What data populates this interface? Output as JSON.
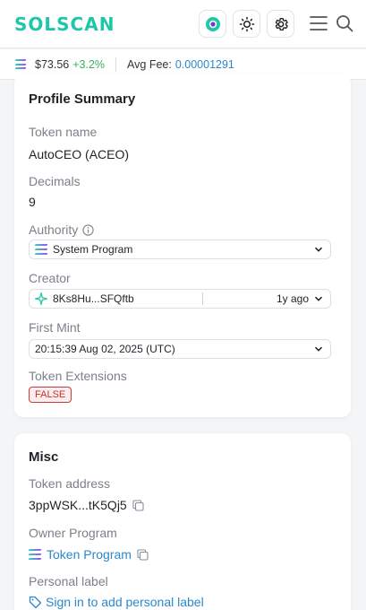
{
  "header": {
    "logo_text": "SOLSCAN",
    "icons": [
      "solscan-app-icon",
      "sun-icon",
      "gear-icon",
      "hamburger-menu-icon",
      "search-icon"
    ]
  },
  "pricebar": {
    "price": "$73.56",
    "change": "+3.2%",
    "fee_label": "Avg Fee:",
    "fee_value": "0.00001291"
  },
  "profile": {
    "title": "Profile Summary",
    "token_name_label": "Token name",
    "token_name": "AutoCEO (ACEO)",
    "decimals_label": "Decimals",
    "decimals": "9",
    "authority_label": "Authority",
    "authority_value": "System Program",
    "creator_label": "Creator",
    "creator_value": "8Ks8Hu...SFQftb",
    "creator_age": "1y ago",
    "first_mint_label": "First Mint",
    "first_mint_value": "20:15:39 Aug 02, 2025 (UTC)",
    "extensions_label": "Token Extensions",
    "extensions_value": "FALSE"
  },
  "misc": {
    "title": "Misc",
    "token_address_label": "Token address",
    "token_address": "3ppWSK...tK5Qj5",
    "owner_program_label": "Owner Program",
    "owner_program": "Token Program",
    "personal_label_label": "Personal label",
    "personal_label_link": "Sign in to add personal label"
  },
  "colors": {
    "brand": "#1fc7a8",
    "link": "#2b88cc",
    "positive": "#36b25b",
    "false_badge": "#c0332f"
  }
}
